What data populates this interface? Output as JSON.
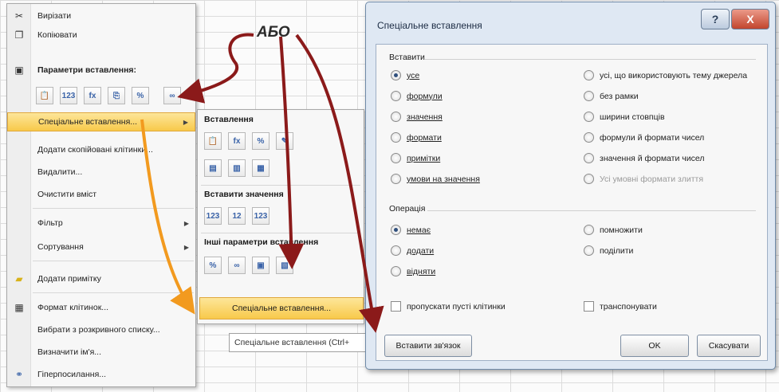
{
  "annotation": {
    "label": "АБО"
  },
  "context_menu": {
    "items": [
      {
        "label": "Вирізати",
        "icon": "scissors-icon",
        "glyph": "✂"
      },
      {
        "label": "Копіювати",
        "icon": "copy-icon",
        "glyph": "❐"
      },
      {
        "label": "Параметри вставлення:",
        "icon": "clipboard-icon",
        "glyph": "▣"
      },
      {
        "label": "Спеціальне вставлення...",
        "highlighted": true,
        "submenu": true
      },
      {
        "label": "Додати скопійовані клітинки..."
      },
      {
        "label": "Видалити..."
      },
      {
        "label": "Очистити вміст"
      },
      {
        "label": "Фільтр",
        "submenu": true
      },
      {
        "label": "Сортування",
        "submenu": true
      },
      {
        "label": "Додати примітку",
        "icon": "comment-icon",
        "glyph": "▰"
      },
      {
        "label": "Формат клітинок...",
        "icon": "format-cells-icon",
        "glyph": "▦"
      },
      {
        "label": "Вибрати з розкривного списку..."
      },
      {
        "label": "Визначити ім'я..."
      },
      {
        "label": "Гіперпосилання...",
        "icon": "hyperlink-icon",
        "glyph": "⚭"
      }
    ],
    "paste_icons": [
      "📋",
      "123",
      "fx",
      "⎘",
      "%",
      "∞"
    ]
  },
  "submenu": {
    "heading_paste": "Вставлення",
    "heading_values": "Вставити значення",
    "heading_other": "Інші параметри вставлення",
    "paste_icons_row1": [
      "📋",
      "fx",
      "%",
      "✎"
    ],
    "paste_icons_row2": [
      "▤",
      "▥",
      "▦"
    ],
    "value_icons": [
      "123",
      "12",
      "123"
    ],
    "other_icons": [
      "%",
      "∞",
      "▣",
      "▧"
    ],
    "last_item": "Спеціальне вставлення..."
  },
  "combo": {
    "text": "Спеціальне вставлення (Ctrl+"
  },
  "dialog": {
    "title": "Спеціальне вставлення",
    "help_glyph": "?",
    "close_glyph": "X",
    "paste_group": "Вставити",
    "paste_left": [
      {
        "label": "усе",
        "checked": true
      },
      {
        "label": "формули"
      },
      {
        "label": "значення"
      },
      {
        "label": "формати"
      },
      {
        "label": "примітки"
      },
      {
        "label": "умови на значення"
      }
    ],
    "paste_right": [
      {
        "label": "усі, що використовують тему джерела"
      },
      {
        "label": "без рамки"
      },
      {
        "label": "ширини стовпців"
      },
      {
        "label": "формули й формати чисел"
      },
      {
        "label": "значення й формати чисел"
      },
      {
        "label": "Усі умовні формати злиття",
        "disabled": true
      }
    ],
    "operation_group": "Операція",
    "op_left": [
      {
        "label": "немає",
        "checked": true
      },
      {
        "label": "додати"
      },
      {
        "label": "відняти"
      }
    ],
    "op_right": [
      {
        "label": "помножити"
      },
      {
        "label": "поділити"
      }
    ],
    "skip_blanks": "пропускати пусті клітинки",
    "transpose": "транспонувати",
    "paste_link_button": "Вставити зв'язок",
    "ok_button": "OK",
    "cancel_button": "Скасувати"
  },
  "colors": {
    "highlight": "#f8c94a",
    "arrow_dark": "#8b1a1a",
    "arrow_orange": "#f29a1f",
    "dialog_bg": "#dfe8f3"
  }
}
